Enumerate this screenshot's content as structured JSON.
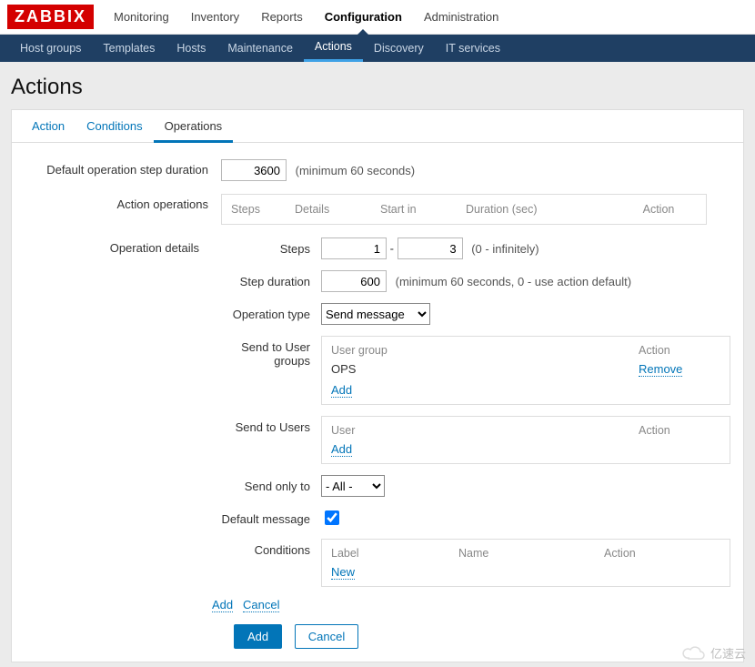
{
  "brand": "ZABBIX",
  "topnav": {
    "items": [
      "Monitoring",
      "Inventory",
      "Reports",
      "Configuration",
      "Administration"
    ],
    "active_index": 3
  },
  "subnav": {
    "items": [
      "Host groups",
      "Templates",
      "Hosts",
      "Maintenance",
      "Actions",
      "Discovery",
      "IT services"
    ],
    "active_index": 4
  },
  "page_title": "Actions",
  "tabs": {
    "items": [
      "Action",
      "Conditions",
      "Operations"
    ],
    "active_index": 2
  },
  "form": {
    "default_step_duration_label": "Default operation step duration",
    "default_step_duration_value": "3600",
    "default_step_duration_hint": "(minimum 60 seconds)",
    "action_operations_label": "Action operations",
    "ops_cols": [
      "Steps",
      "Details",
      "Start in",
      "Duration (sec)",
      "Action"
    ],
    "operation_details_label": "Operation details",
    "detail": {
      "steps_label": "Steps",
      "steps_from": "1",
      "steps_sep": "-",
      "steps_to": "3",
      "steps_hint": "(0 - infinitely)",
      "step_duration_label": "Step duration",
      "step_duration_value": "600",
      "step_duration_hint": "(minimum 60 seconds, 0 - use action default)",
      "operation_type_label": "Operation type",
      "operation_type_value": "Send message",
      "send_user_groups_label": "Send to User groups",
      "ug_head": {
        "col1": "User group",
        "col2": "Action"
      },
      "ug_rows": [
        {
          "name": "OPS",
          "action": "Remove"
        }
      ],
      "ug_add": "Add",
      "send_users_label": "Send to Users",
      "u_head": {
        "col1": "User",
        "col2": "Action"
      },
      "u_add": "Add",
      "send_only_to_label": "Send only to",
      "send_only_to_value": "- All -",
      "default_message_label": "Default message",
      "default_message_checked": true,
      "conditions_label": "Conditions",
      "cond_head": [
        "Label",
        "Name",
        "Action"
      ],
      "cond_new": "New",
      "links": {
        "add": "Add",
        "cancel": "Cancel"
      }
    },
    "buttons": {
      "add": "Add",
      "cancel": "Cancel"
    }
  },
  "watermark": "亿速云"
}
